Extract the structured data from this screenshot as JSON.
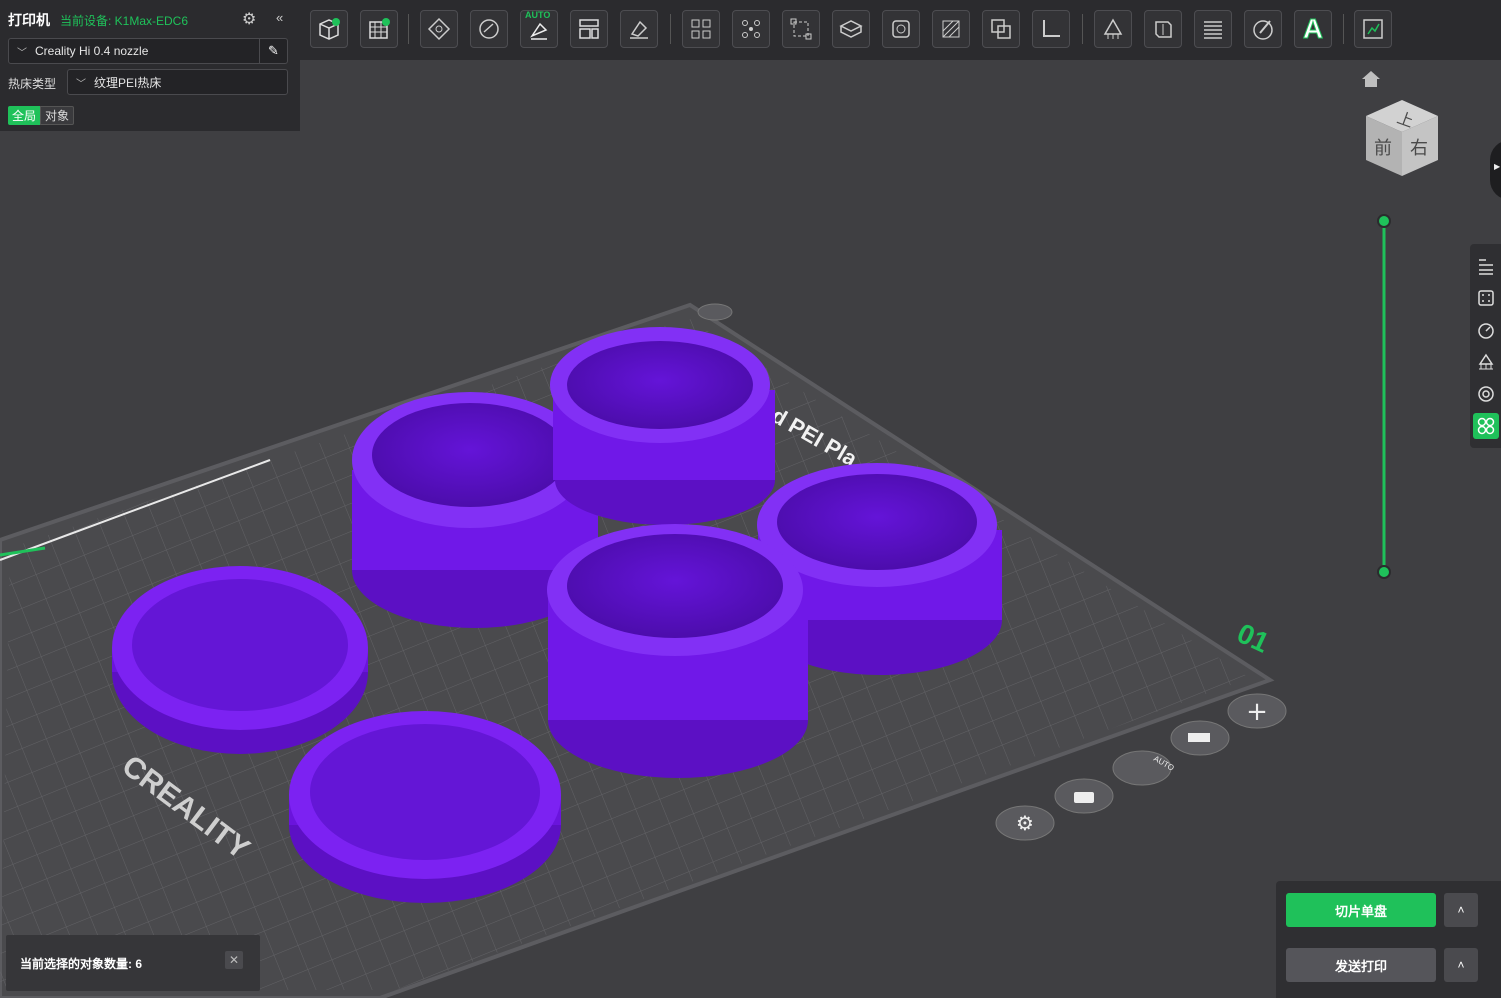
{
  "printer_panel": {
    "title": "打印机",
    "current_device": "当前设备: K1Max-EDC6",
    "nozzle": "Creality Hi 0.4 nozzle",
    "bed_label": "热床类型",
    "bed_type": "纹理PEI热床",
    "scope_global": "全局",
    "scope_object": "对象"
  },
  "toolbar": {
    "auto_tag": "AUTO",
    "icons": [
      "add-object-icon",
      "add-plate-icon",
      "arrange-icon",
      "orient-icon",
      "auto-orient-icon",
      "split-icon",
      "lay-on-face-icon",
      "layout-icon",
      "arrange-grid-icon",
      "scale-icon",
      "cube-view-icon",
      "hollow-icon",
      "cut-icon",
      "boolean-icon",
      "measure-icon",
      "support-paint-icon",
      "seam-paint-icon",
      "slice-view-icon",
      "color-paint-icon",
      "text-icon",
      "assembly-icon"
    ],
    "text_glyph": "A"
  },
  "view_cube": {
    "top": "上",
    "front": "前",
    "right": "右"
  },
  "bed": {
    "brand": "CREALITY",
    "plate_text": "d PEI Pla",
    "plate_number": "01",
    "bottom_auto": "AUTO"
  },
  "status": {
    "selection": "当前选择的对象数量: 6",
    "close": "✕"
  },
  "actions": {
    "slice": "切片单盘",
    "send": "发送打印",
    "arrow": "˄"
  },
  "colors": {
    "accent": "#1fc15a",
    "object": "#7a1cf0",
    "object_dark": "#4f0fb5",
    "bed": "#4c4c50",
    "background": "#3f3f42"
  }
}
